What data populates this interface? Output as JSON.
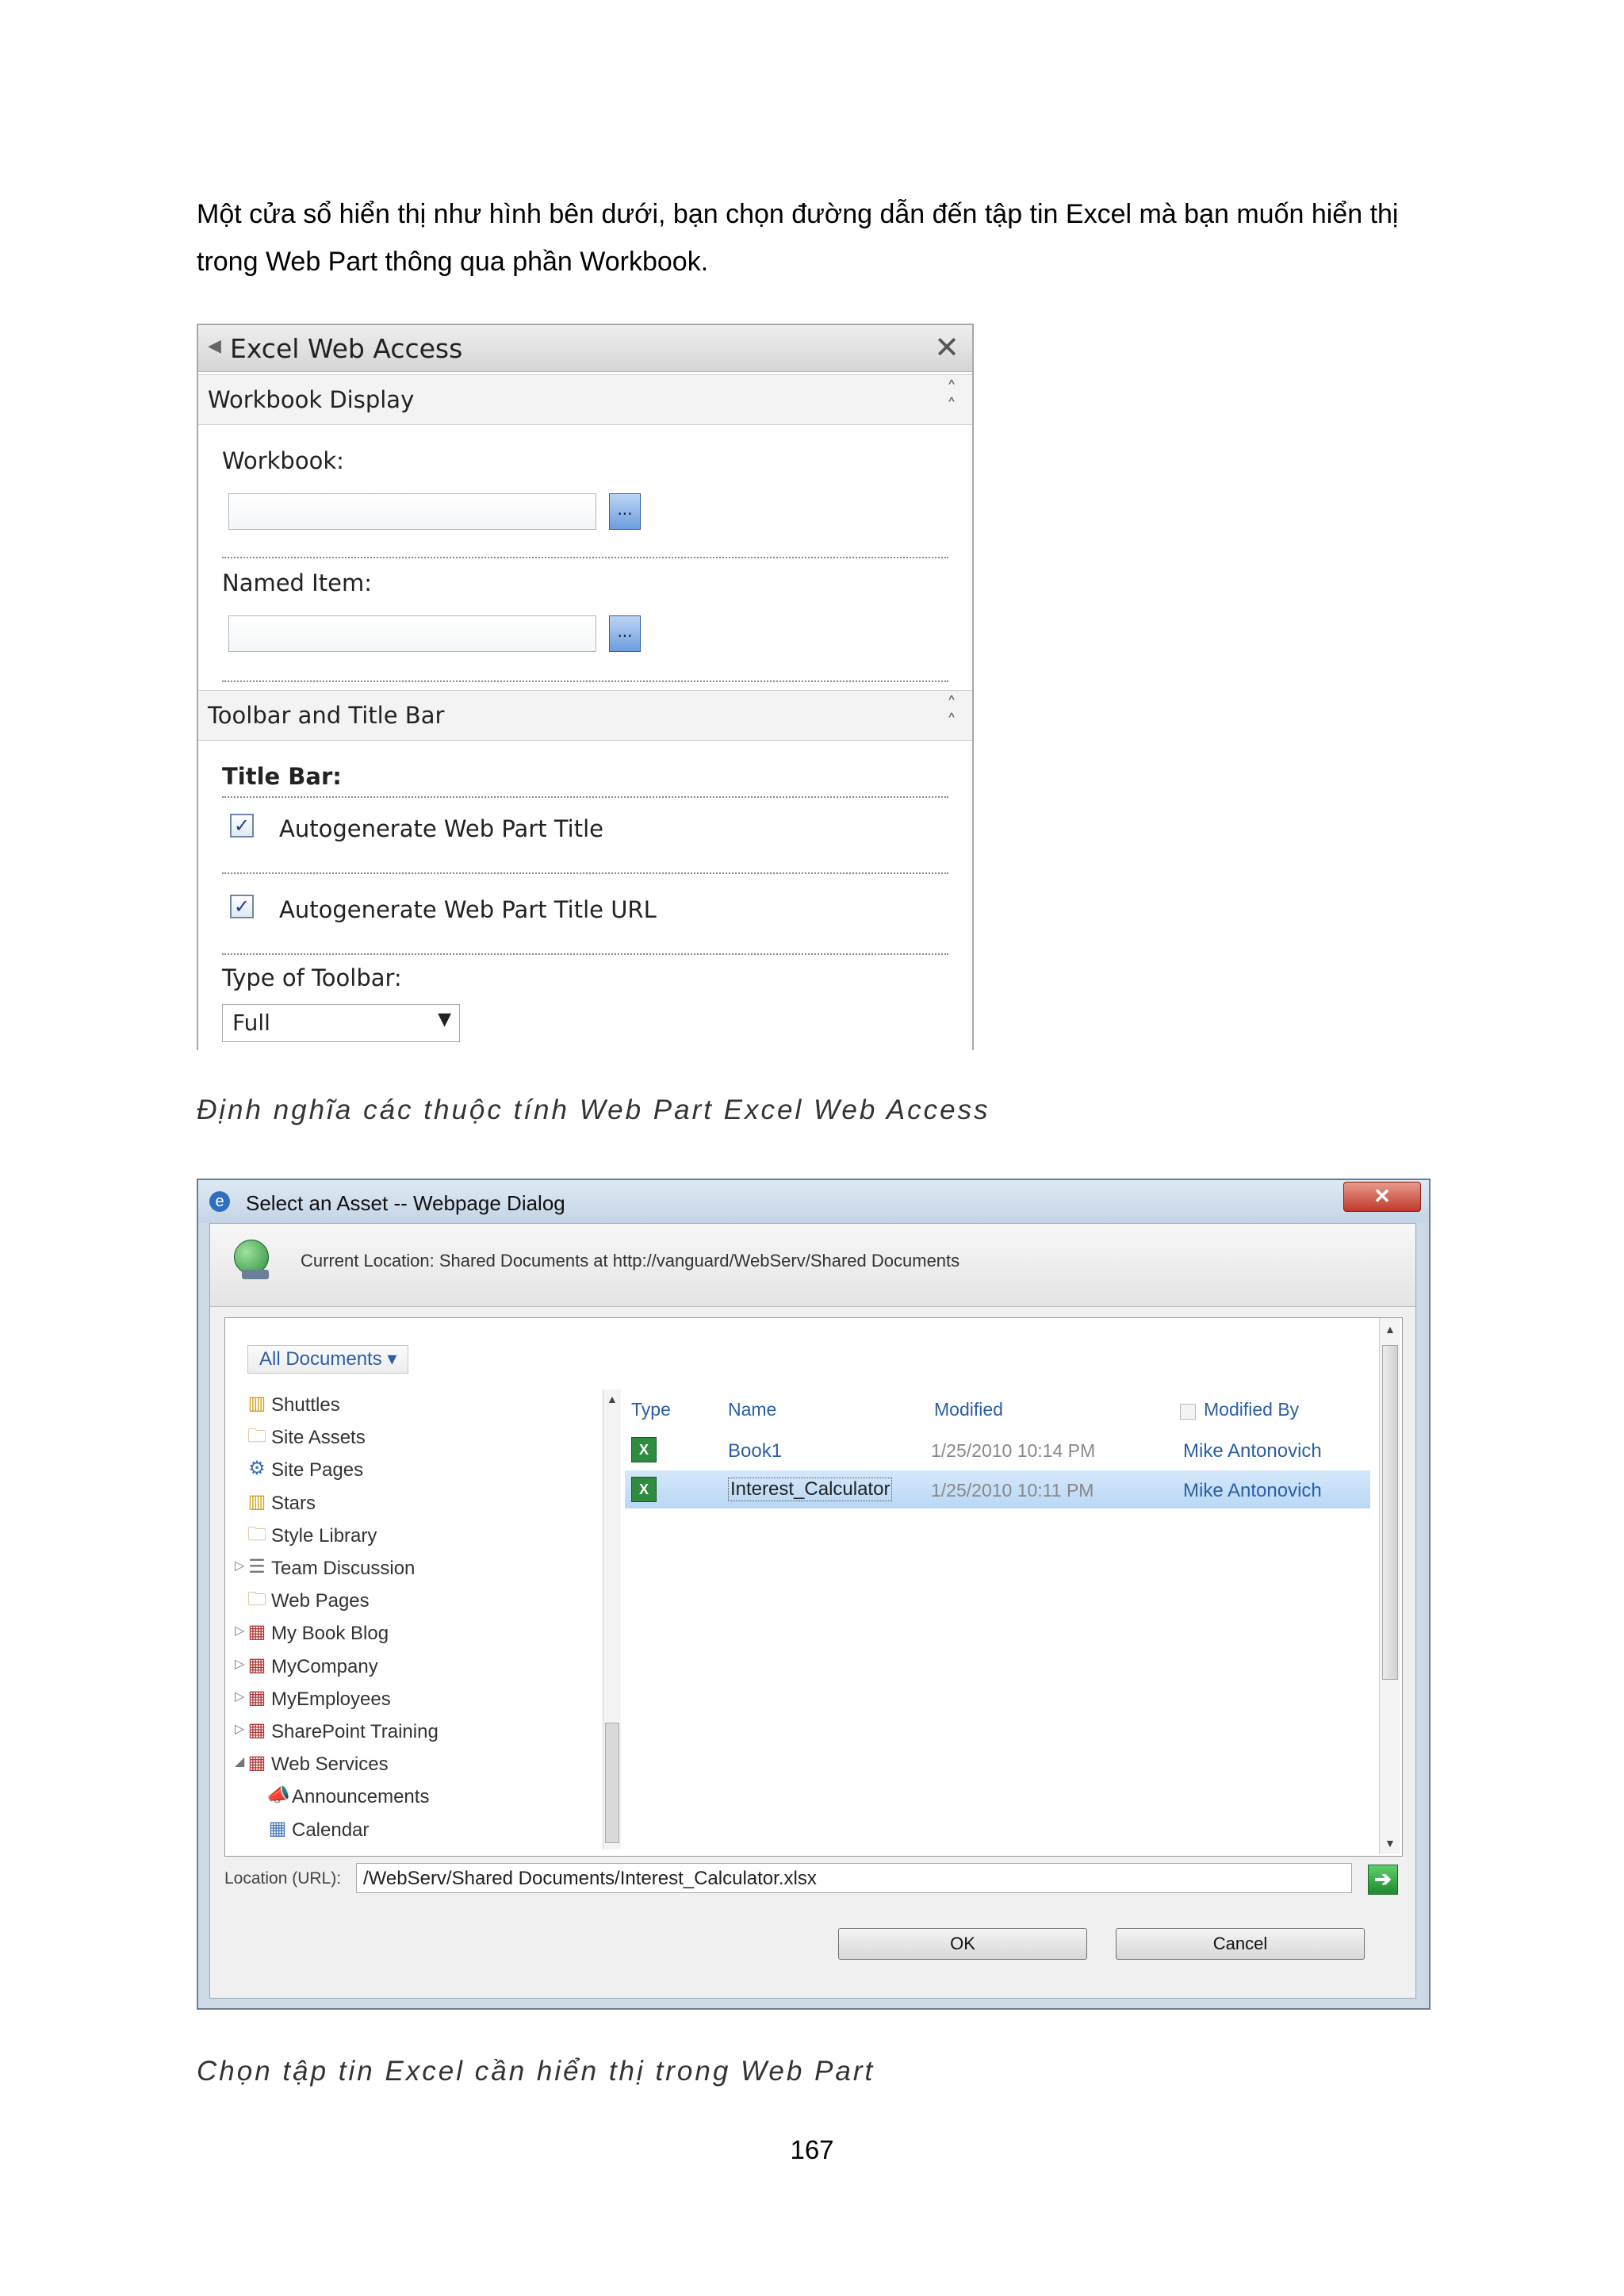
{
  "intro": {
    "line1": "Một cửa sổ hiển thị như hình bên dưới, bạn chọn đường dẫn đến tập tin Excel mà bạn muốn hiển thị",
    "line2": "trong Web Part thông qua phần Workbook."
  },
  "tool_pane": {
    "title": "Excel Web Access",
    "close_glyph": "✕",
    "section_workbook_display": "Workbook Display",
    "workbook_label": "Workbook:",
    "workbook_value": "",
    "browse_glyph": "...",
    "named_item_label": "Named Item:",
    "named_item_value": "",
    "section_toolbar": "Toolbar and Title Bar",
    "title_bar_label": "Title Bar:",
    "checkbox1_label": "Autogenerate Web Part Title",
    "checkbox2_label": "Autogenerate Web Part Title URL",
    "checkbox_glyph": "✓",
    "toolbar_type_label": "Type of Toolbar:",
    "toolbar_type_value": "Full"
  },
  "caption1": "Định nghĩa các thuộc tính Web Part Excel Web Access",
  "dialog": {
    "title": "Select an Asset -- Webpage Dialog",
    "close_glyph": "✕",
    "current_location": "Current Location: Shared Documents at http://vanguard/WebServ/Shared Documents",
    "view_selector": "All Documents ▾",
    "tree": [
      {
        "label": "Shuttles",
        "icon": "list-icon",
        "expand": ""
      },
      {
        "label": "Site Assets",
        "icon": "folder-icon",
        "expand": ""
      },
      {
        "label": "Site Pages",
        "icon": "pages-icon",
        "expand": ""
      },
      {
        "label": "Stars",
        "icon": "list-icon",
        "expand": ""
      },
      {
        "label": "Style Library",
        "icon": "folder-icon",
        "expand": ""
      },
      {
        "label": "Team Discussion",
        "icon": "discussion-icon",
        "expand": "▷"
      },
      {
        "label": "Web Pages",
        "icon": "folder-icon",
        "expand": ""
      },
      {
        "label": "My Book Blog",
        "icon": "site-icon",
        "expand": "▷"
      },
      {
        "label": "MyCompany",
        "icon": "site-icon",
        "expand": "▷"
      },
      {
        "label": "MyEmployees",
        "icon": "site-icon",
        "expand": "▷"
      },
      {
        "label": "SharePoint Training",
        "icon": "site-icon",
        "expand": "▷"
      },
      {
        "label": "Web Services",
        "icon": "site-icon",
        "expand": "◢"
      },
      {
        "label": "Announcements",
        "icon": "announcement-icon",
        "expand": ""
      },
      {
        "label": "Calendar",
        "icon": "calendar-icon",
        "expand": ""
      }
    ],
    "columns": {
      "type": "Type",
      "name": "Name",
      "modified": "Modified",
      "modified_by": "Modified By"
    },
    "rows": [
      {
        "name": "Book1",
        "modified": "1/25/2010 10:14 PM",
        "modified_by": "Mike Antonovich",
        "selected": false
      },
      {
        "name": "Interest_Calculator",
        "modified": "1/25/2010 10:11 PM",
        "modified_by": "Mike Antonovich",
        "selected": true
      }
    ],
    "location_label": "Location (URL):",
    "location_value": "/WebServ/Shared Documents/Interest_Calculator.xlsx",
    "ok_label": "OK",
    "cancel_label": "Cancel"
  },
  "caption2": "Chọn tập tin Excel cần hiển thị trong Web Part",
  "page_number": "167"
}
